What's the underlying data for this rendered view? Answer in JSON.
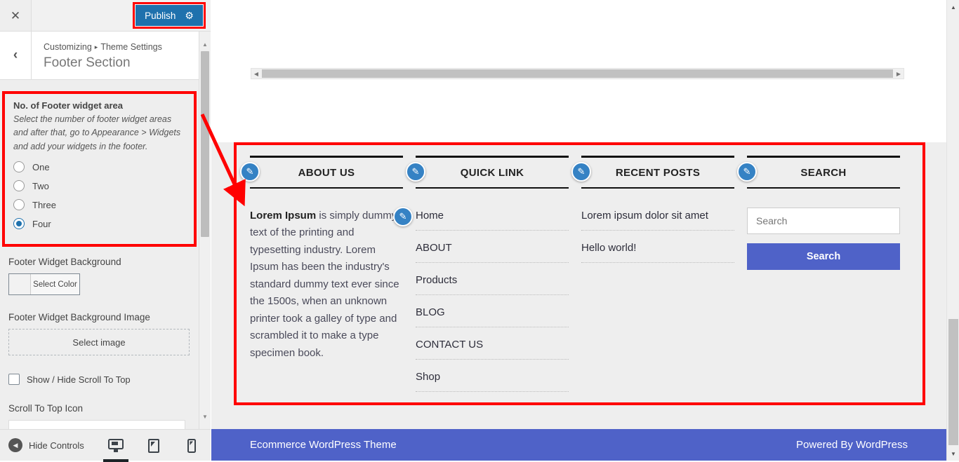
{
  "customizer": {
    "close_icon": "close-icon",
    "publish_label": "Publish",
    "gear_icon": "gear-icon",
    "back_icon": "chevron-left-icon",
    "breadcrumb_root": "Customizing",
    "breadcrumb_sep": "▸",
    "breadcrumb_parent": "Theme Settings",
    "section_title": "Footer Section",
    "footer_count": {
      "label": "No. of Footer widget area",
      "description": "Select the number of footer widget areas and after that, go to Appearance > Widgets and add your widgets in the footer.",
      "options": [
        {
          "label": "One",
          "checked": false
        },
        {
          "label": "Two",
          "checked": false
        },
        {
          "label": "Three",
          "checked": false
        },
        {
          "label": "Four",
          "checked": true
        }
      ]
    },
    "widget_background": {
      "label": "Footer Widget Background",
      "button_label": "Select Color"
    },
    "widget_background_image": {
      "label": "Footer Widget Background Image",
      "button_label": "Select image"
    },
    "scroll_to_top": {
      "label": "Show / Hide Scroll To Top",
      "checked": false
    },
    "scroll_to_top_icon": {
      "label": "Scroll To Top Icon"
    },
    "hide_controls_label": "Hide Controls",
    "devices": [
      {
        "name": "desktop",
        "active": true
      },
      {
        "name": "tablet",
        "active": false
      },
      {
        "name": "mobile",
        "active": false
      }
    ]
  },
  "preview": {
    "widgets": [
      {
        "title": "ABOUT US",
        "type": "text",
        "body_html": "is simply dummy text of the printing and typesetting industry. Lorem Ipsum has been the industry's standard dummy text ever since the 1500s, when an unknown printer took a galley of type and scrambled it to make a type specimen book.",
        "body_lead": "Lorem Ipsum"
      },
      {
        "title": "QUICK LINK",
        "type": "links",
        "items": [
          "Home",
          "ABOUT",
          "Products",
          "BLOG",
          "CONTACT US",
          "Shop"
        ]
      },
      {
        "title": "RECENT POSTS",
        "type": "posts",
        "items": [
          "Lorem ipsum dolor sit amet",
          "Hello world!"
        ]
      },
      {
        "title": "SEARCH",
        "type": "search",
        "search_placeholder": "Search",
        "search_value": "",
        "search_button": "Search"
      }
    ],
    "copyright_left": "Ecommerce WordPress Theme",
    "copyright_right": "Powered By WordPress"
  },
  "colors": {
    "publish_blue": "#1e71ad",
    "annotation_red": "#ff0000",
    "footer_bar_blue": "#4f62c8",
    "pencil_blue": "#3582c4",
    "footer_bg": "#eeeeee"
  }
}
